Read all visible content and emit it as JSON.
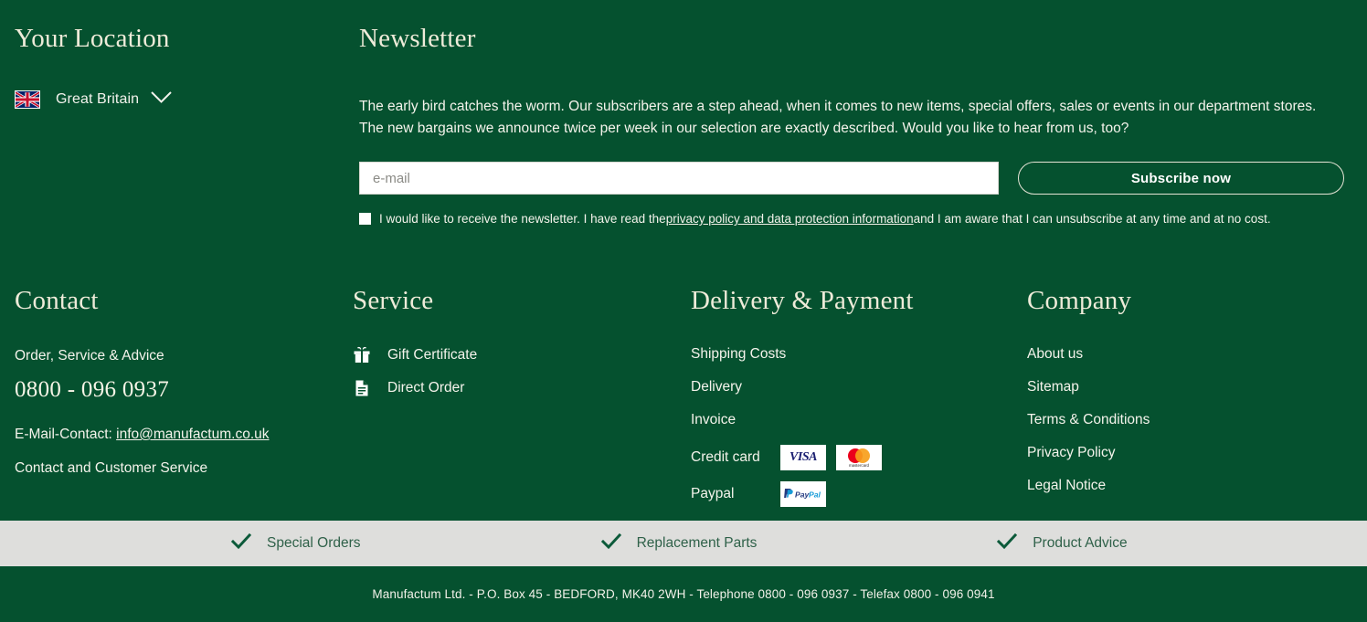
{
  "location": {
    "heading": "Your Location",
    "country": "Great Britain",
    "flag_icon": "uk-flag-icon",
    "chevron_icon": "chevron-down-icon"
  },
  "newsletter": {
    "heading": "Newsletter",
    "paragraph_line1": "The early bird catches the worm. Our subscribers are a step ahead, when it comes to new items, special offers, sales or events in our department stores.",
    "paragraph_line2": "The new bargains we announce twice per week in our selection are exactly described. Would you like to hear from us, too?",
    "email_placeholder": "e-mail",
    "email_value": "",
    "subscribe_label": "Subscribe now",
    "consent_before": "I would like to receive the newsletter. I have read the ",
    "consent_link": "privacy policy and data protection information",
    "consent_after": " and I am aware that I can unsubscribe at any time and at no cost.",
    "checkbox_checked": false
  },
  "contact": {
    "heading": "Contact",
    "subtitle": "Order, Service & Advice",
    "phone": "0800 - 096 0937",
    "email_prefix": "E-Mail-Contact: ",
    "email": "info@manufactum.co.uk",
    "service_link": "Contact and Customer Service"
  },
  "service": {
    "heading": "Service",
    "items": [
      {
        "label": "Gift Certificate",
        "icon": "gift-icon"
      },
      {
        "label": "Direct Order",
        "icon": "document-icon"
      }
    ]
  },
  "delivery": {
    "heading": "Delivery & Payment",
    "links": [
      "Shipping Costs",
      "Delivery",
      "Invoice"
    ],
    "credit_card_label": "Credit card",
    "credit_card_badges": [
      "visa-logo",
      "mastercard-logo"
    ],
    "paypal_label": "Paypal",
    "paypal_badges": [
      "paypal-logo"
    ]
  },
  "company": {
    "heading": "Company",
    "links": [
      "About us",
      "Sitemap",
      "Terms & Conditions",
      "Privacy Policy",
      "Legal Notice"
    ]
  },
  "benefits": [
    {
      "label": "Special Orders",
      "icon": "check-icon"
    },
    {
      "label": "Replacement Parts",
      "icon": "check-icon"
    },
    {
      "label": "Product Advice",
      "icon": "check-icon"
    }
  ],
  "bottom_bar": {
    "text": "Manufactum Ltd. - P.O. Box 45 - BEDFORD, MK40 2WH - Telephone 0800 - 096 0937 - Telefax 0800 - 096 0941"
  },
  "colors": {
    "background_green": "#05512F",
    "heading_cream": "#EEEBD9",
    "body_text": "#F4F3EB",
    "benefits_bar": "#DEDEDC",
    "benefits_text": "#2F6149",
    "visa_blue": "#1A1F71",
    "mastercard_red": "#EB001B",
    "mastercard_orange": "#F79E1B",
    "paypal_blue": "#253B80",
    "paypal_lightblue": "#179BD7"
  }
}
